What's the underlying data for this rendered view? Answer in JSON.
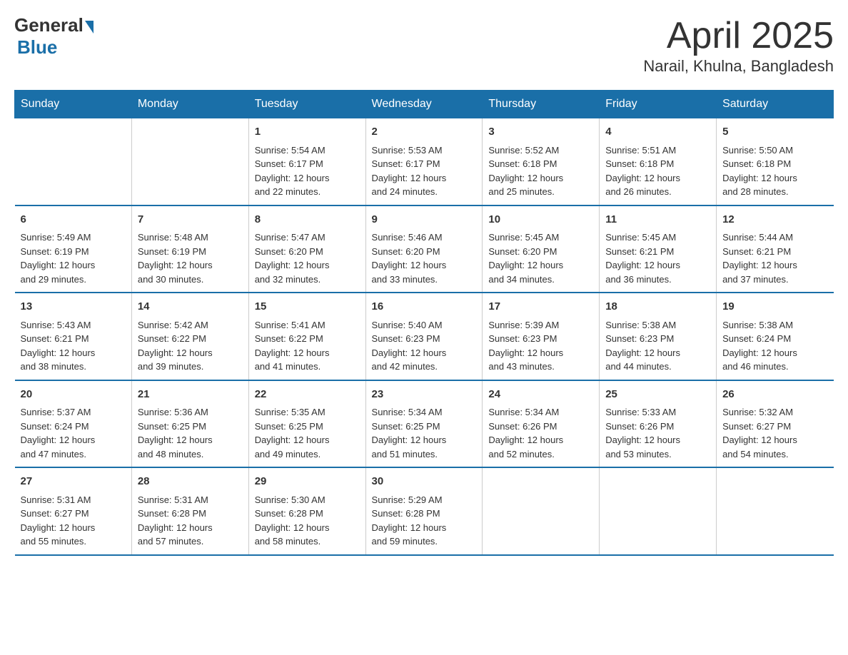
{
  "header": {
    "logo_general": "General",
    "logo_blue": "Blue",
    "title": "April 2025",
    "subtitle": "Narail, Khulna, Bangladesh"
  },
  "days_of_week": [
    "Sunday",
    "Monday",
    "Tuesday",
    "Wednesday",
    "Thursday",
    "Friday",
    "Saturday"
  ],
  "weeks": [
    [
      {
        "day": "",
        "info": ""
      },
      {
        "day": "",
        "info": ""
      },
      {
        "day": "1",
        "info": "Sunrise: 5:54 AM\nSunset: 6:17 PM\nDaylight: 12 hours\nand 22 minutes."
      },
      {
        "day": "2",
        "info": "Sunrise: 5:53 AM\nSunset: 6:17 PM\nDaylight: 12 hours\nand 24 minutes."
      },
      {
        "day": "3",
        "info": "Sunrise: 5:52 AM\nSunset: 6:18 PM\nDaylight: 12 hours\nand 25 minutes."
      },
      {
        "day": "4",
        "info": "Sunrise: 5:51 AM\nSunset: 6:18 PM\nDaylight: 12 hours\nand 26 minutes."
      },
      {
        "day": "5",
        "info": "Sunrise: 5:50 AM\nSunset: 6:18 PM\nDaylight: 12 hours\nand 28 minutes."
      }
    ],
    [
      {
        "day": "6",
        "info": "Sunrise: 5:49 AM\nSunset: 6:19 PM\nDaylight: 12 hours\nand 29 minutes."
      },
      {
        "day": "7",
        "info": "Sunrise: 5:48 AM\nSunset: 6:19 PM\nDaylight: 12 hours\nand 30 minutes."
      },
      {
        "day": "8",
        "info": "Sunrise: 5:47 AM\nSunset: 6:20 PM\nDaylight: 12 hours\nand 32 minutes."
      },
      {
        "day": "9",
        "info": "Sunrise: 5:46 AM\nSunset: 6:20 PM\nDaylight: 12 hours\nand 33 minutes."
      },
      {
        "day": "10",
        "info": "Sunrise: 5:45 AM\nSunset: 6:20 PM\nDaylight: 12 hours\nand 34 minutes."
      },
      {
        "day": "11",
        "info": "Sunrise: 5:45 AM\nSunset: 6:21 PM\nDaylight: 12 hours\nand 36 minutes."
      },
      {
        "day": "12",
        "info": "Sunrise: 5:44 AM\nSunset: 6:21 PM\nDaylight: 12 hours\nand 37 minutes."
      }
    ],
    [
      {
        "day": "13",
        "info": "Sunrise: 5:43 AM\nSunset: 6:21 PM\nDaylight: 12 hours\nand 38 minutes."
      },
      {
        "day": "14",
        "info": "Sunrise: 5:42 AM\nSunset: 6:22 PM\nDaylight: 12 hours\nand 39 minutes."
      },
      {
        "day": "15",
        "info": "Sunrise: 5:41 AM\nSunset: 6:22 PM\nDaylight: 12 hours\nand 41 minutes."
      },
      {
        "day": "16",
        "info": "Sunrise: 5:40 AM\nSunset: 6:23 PM\nDaylight: 12 hours\nand 42 minutes."
      },
      {
        "day": "17",
        "info": "Sunrise: 5:39 AM\nSunset: 6:23 PM\nDaylight: 12 hours\nand 43 minutes."
      },
      {
        "day": "18",
        "info": "Sunrise: 5:38 AM\nSunset: 6:23 PM\nDaylight: 12 hours\nand 44 minutes."
      },
      {
        "day": "19",
        "info": "Sunrise: 5:38 AM\nSunset: 6:24 PM\nDaylight: 12 hours\nand 46 minutes."
      }
    ],
    [
      {
        "day": "20",
        "info": "Sunrise: 5:37 AM\nSunset: 6:24 PM\nDaylight: 12 hours\nand 47 minutes."
      },
      {
        "day": "21",
        "info": "Sunrise: 5:36 AM\nSunset: 6:25 PM\nDaylight: 12 hours\nand 48 minutes."
      },
      {
        "day": "22",
        "info": "Sunrise: 5:35 AM\nSunset: 6:25 PM\nDaylight: 12 hours\nand 49 minutes."
      },
      {
        "day": "23",
        "info": "Sunrise: 5:34 AM\nSunset: 6:25 PM\nDaylight: 12 hours\nand 51 minutes."
      },
      {
        "day": "24",
        "info": "Sunrise: 5:34 AM\nSunset: 6:26 PM\nDaylight: 12 hours\nand 52 minutes."
      },
      {
        "day": "25",
        "info": "Sunrise: 5:33 AM\nSunset: 6:26 PM\nDaylight: 12 hours\nand 53 minutes."
      },
      {
        "day": "26",
        "info": "Sunrise: 5:32 AM\nSunset: 6:27 PM\nDaylight: 12 hours\nand 54 minutes."
      }
    ],
    [
      {
        "day": "27",
        "info": "Sunrise: 5:31 AM\nSunset: 6:27 PM\nDaylight: 12 hours\nand 55 minutes."
      },
      {
        "day": "28",
        "info": "Sunrise: 5:31 AM\nSunset: 6:28 PM\nDaylight: 12 hours\nand 57 minutes."
      },
      {
        "day": "29",
        "info": "Sunrise: 5:30 AM\nSunset: 6:28 PM\nDaylight: 12 hours\nand 58 minutes."
      },
      {
        "day": "30",
        "info": "Sunrise: 5:29 AM\nSunset: 6:28 PM\nDaylight: 12 hours\nand 59 minutes."
      },
      {
        "day": "",
        "info": ""
      },
      {
        "day": "",
        "info": ""
      },
      {
        "day": "",
        "info": ""
      }
    ]
  ]
}
